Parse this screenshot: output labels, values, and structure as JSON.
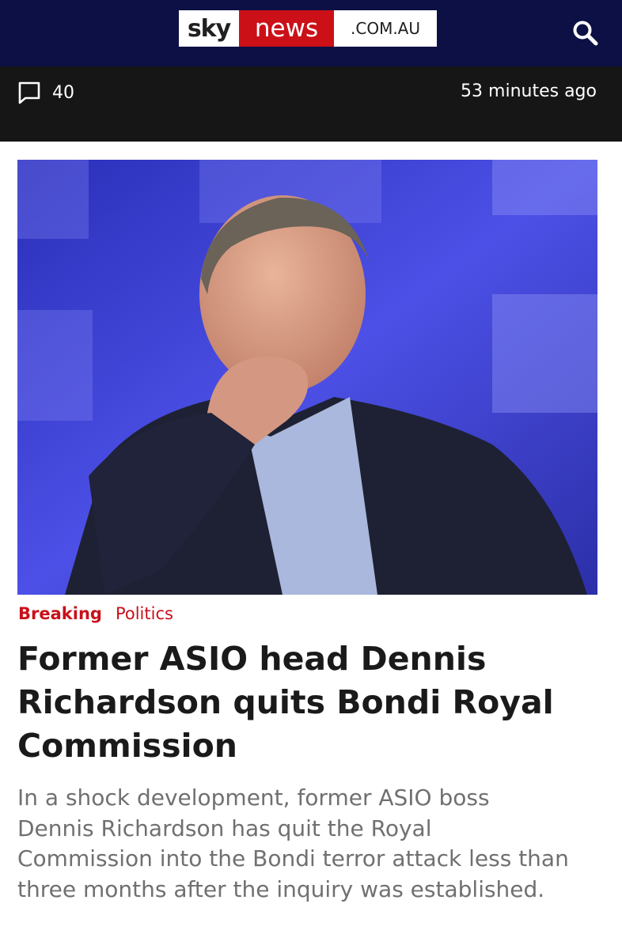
{
  "header": {
    "logo": {
      "sky": "sky",
      "news": "news",
      "domain": ".COM.AU"
    },
    "search_icon": "search-icon",
    "colors": {
      "background": "#0d1045",
      "news_red": "#cc1018"
    }
  },
  "meta": {
    "comment_icon": "comment-icon",
    "comment_count": "40",
    "time_ago": "53 minutes ago"
  },
  "article": {
    "tags": {
      "breaking": "Breaking",
      "category": "Politics"
    },
    "headline": "Former ASIO head Dennis Richardson quits Bondi Royal Commission",
    "standfirst": "In a shock development, former ASIO boss Dennis Richardson has quit the Royal Commission into the Bondi terror attack less than three months after the inquiry was established.",
    "accent_color": "#c8101a"
  }
}
